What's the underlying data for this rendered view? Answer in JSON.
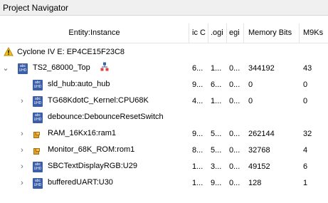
{
  "window": {
    "title": "Project Navigator"
  },
  "columns": [
    "Entity:Instance",
    "ic C",
    ".ogi",
    "egi",
    "Memory Bits",
    "M9Ks"
  ],
  "device": {
    "label": "Cyclone IV E: EP4CE15F23C8"
  },
  "rows": [
    {
      "name": "TS2_68000_Top",
      "c1": "6...",
      "c2": "1...",
      "c3": "0...",
      "mem": "344192",
      "m9k": "43"
    },
    {
      "name": "sld_hub:auto_hub",
      "c1": "9...",
      "c2": "6...",
      "c3": "0...",
      "mem": "0",
      "m9k": "0"
    },
    {
      "name": "TG68KdotC_Kernel:CPU68K",
      "c1": "4...",
      "c2": "1...",
      "c3": "0...",
      "mem": "0",
      "m9k": "0"
    },
    {
      "name": "debounce:DebounceResetSwitch",
      "c1": "",
      "c2": "",
      "c3": "",
      "mem": "",
      "m9k": ""
    },
    {
      "name": "RAM_16Kx16:ram1",
      "c1": "9...",
      "c2": "5...",
      "c3": "0...",
      "mem": "262144",
      "m9k": "32"
    },
    {
      "name": "Monitor_68K_ROM:rom1",
      "c1": "8...",
      "c2": "5...",
      "c3": "0...",
      "mem": "32768",
      "m9k": "4"
    },
    {
      "name": "SBCTextDisplayRGB:U29",
      "c1": "1...",
      "c2": "3...",
      "c3": "0...",
      "mem": "49152",
      "m9k": "6"
    },
    {
      "name": "bufferedUART:U30",
      "c1": "1...",
      "c2": "9...",
      "c3": "0...",
      "mem": "128",
      "m9k": "1"
    }
  ],
  "icon_labels": {
    "abc": "abc",
    "uhd": "UHD"
  }
}
